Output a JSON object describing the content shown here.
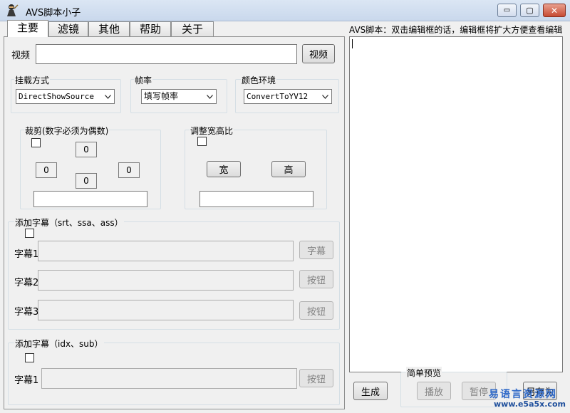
{
  "window": {
    "title": "AVS脚本小子",
    "minimize_glyph": "▭",
    "maximize_glyph": "▢",
    "close_glyph": "✕",
    "icon": "ninja-icon"
  },
  "tabs": [
    {
      "label": "主要",
      "active": true
    },
    {
      "label": "滤镜",
      "active": false
    },
    {
      "label": "其他",
      "active": false
    },
    {
      "label": "帮助",
      "active": false
    },
    {
      "label": "关于",
      "active": false
    }
  ],
  "video": {
    "label": "视频",
    "value": "",
    "button": "视频"
  },
  "load_method": {
    "title": "挂载方式",
    "selected": "DirectShowSource"
  },
  "frame_rate": {
    "title": "帧率",
    "selected": "填写帧率"
  },
  "color_space": {
    "title": "颜色环境",
    "selected": "ConvertToYV12"
  },
  "crop": {
    "title": "裁剪(数字必须为偶数)",
    "top": "0",
    "left": "0",
    "bottom": "0",
    "right": "0",
    "result": ""
  },
  "aspect": {
    "title": "调整宽高比",
    "width_button": "宽",
    "height_button": "高",
    "result": ""
  },
  "subtitles_text": {
    "title": "添加字幕（srt、ssa、ass）",
    "rows": [
      {
        "label": "字幕1",
        "value": "",
        "button": "字幕"
      },
      {
        "label": "字幕2",
        "value": "",
        "button": "按钮"
      },
      {
        "label": "字幕3",
        "value": "",
        "button": "按钮"
      }
    ]
  },
  "subtitles_idx": {
    "title": "添加字幕（idx、sub）",
    "rows": [
      {
        "label": "字幕1",
        "value": "",
        "button": "按钮"
      }
    ]
  },
  "script_hint": "AVS脚本：双击编辑框的话，编辑框将扩大方便查看编辑",
  "bottom": {
    "generate": "生成",
    "preview_title": "简单预览",
    "play": "播放",
    "pause": "暂停",
    "save_as": "另存为"
  },
  "watermark": {
    "line1": "易语言资源网",
    "line2": "www.e5a5x.com"
  }
}
